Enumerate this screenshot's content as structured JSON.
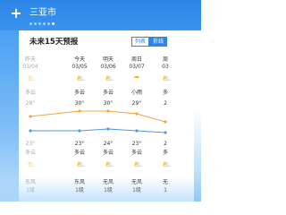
{
  "header": {
    "add_icon": "plus-icon",
    "city": "三亚市",
    "page_dots": 6,
    "active_dot": 5
  },
  "forecast": {
    "title": "未来15天预报",
    "toggle": [
      "列表",
      "折线"
    ],
    "active_toggle": 1,
    "days": [
      {
        "day": "昨天",
        "date": "03/04",
        "day_weather": "多云",
        "day_icon": "partly-cloudy-icon",
        "high": "28°",
        "low": "23°",
        "night_weather": "多云",
        "night_icon": "partly-cloudy-icon",
        "wind": "东风",
        "level": "1级",
        "past": true
      },
      {
        "day": "今天",
        "date": "03/05",
        "day_weather": "多云",
        "day_icon": "partly-cloudy-icon",
        "high": "30°",
        "low": "23°",
        "night_weather": "多云",
        "night_icon": "partly-cloudy-icon",
        "wind": "东风",
        "level": "1级",
        "past": false
      },
      {
        "day": "明天",
        "date": "03/06",
        "day_weather": "多云",
        "day_icon": "partly-cloudy-icon",
        "high": "30°",
        "low": "24°",
        "night_weather": "多云",
        "night_icon": "partly-cloudy-icon",
        "wind": "无风",
        "level": "1级",
        "past": false
      },
      {
        "day": "周日",
        "date": "03/07",
        "day_weather": "小雨",
        "day_icon": "rain-icon",
        "high": "29°",
        "low": "23°",
        "night_weather": "多云",
        "night_icon": "partly-cloudy-icon",
        "wind": "无风",
        "level": "1级",
        "past": false
      },
      {
        "day": "周",
        "date": "03",
        "day_weather": "多",
        "day_icon": "partly-cloudy-icon",
        "high": "2",
        "low": "2",
        "night_weather": "多",
        "night_icon": "partly-cloudy-icon",
        "wind": "无",
        "level": "1",
        "past": false
      }
    ],
    "high_values": [
      28,
      30,
      30,
      29,
      26
    ],
    "low_values": [
      23,
      23,
      24,
      23,
      22
    ],
    "colors": {
      "high_line": "#f0a742",
      "low_line": "#4a9be8",
      "accent": "#2d86e6"
    }
  }
}
